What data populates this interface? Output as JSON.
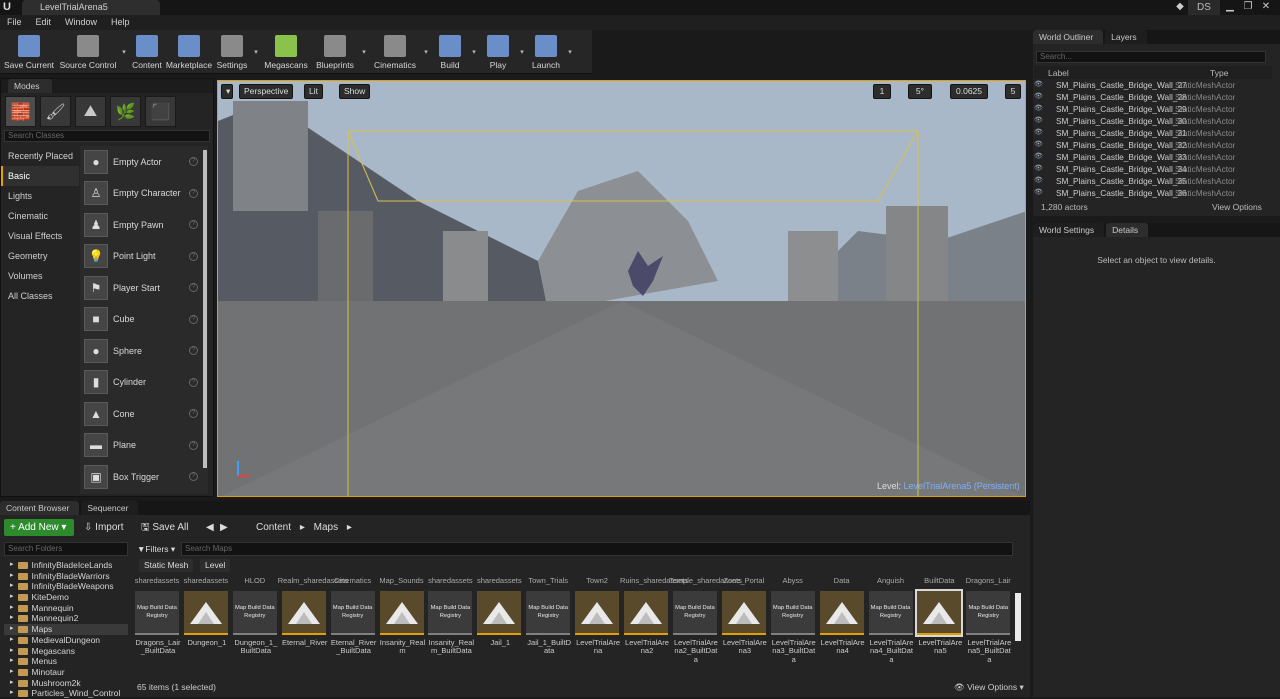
{
  "window": {
    "tab_title": "LevelTrialArena5",
    "user_badge": "DS"
  },
  "menu": [
    "File",
    "Edit",
    "Window",
    "Help"
  ],
  "toolbar": [
    {
      "label": "Save Current",
      "color": "#6a8fc8"
    },
    {
      "label": "Source Control",
      "color": "#8a8a8a"
    },
    {
      "label": "Content",
      "color": "#6a8fc8"
    },
    {
      "label": "Marketplace",
      "color": "#6a8fc8"
    },
    {
      "label": "Settings",
      "color": "#8a8a8a"
    },
    {
      "label": "Megascans",
      "color": "#8bc34a"
    },
    {
      "label": "Blueprints",
      "color": "#8a8a8a"
    },
    {
      "label": "Cinematics",
      "color": "#8a8a8a"
    },
    {
      "label": "Build",
      "color": "#6a8fc8"
    },
    {
      "label": "Play",
      "color": "#6a8fc8"
    },
    {
      "label": "Launch",
      "color": "#6a8fc8"
    }
  ],
  "modes": {
    "tab": "Modes",
    "search_placeholder": "Search Classes",
    "categories": [
      "Recently Placed",
      "Basic",
      "Lights",
      "Cinematic",
      "Visual Effects",
      "Geometry",
      "Volumes",
      "All Classes"
    ],
    "selected_category": "Basic",
    "items": [
      "Empty Actor",
      "Empty Character",
      "Empty Pawn",
      "Point Light",
      "Player Start",
      "Cube",
      "Sphere",
      "Cylinder",
      "Cone",
      "Plane",
      "Box Trigger"
    ]
  },
  "viewport": {
    "perspective": "Perspective",
    "lit": "Lit",
    "show": "Show",
    "grid_snap": "1",
    "angle_snap": "5°",
    "scale_snap": "0.0625",
    "cam_speed": "5",
    "level_label": "Level:",
    "level_name": "LevelTrialArena5 (Persistent)"
  },
  "outliner": {
    "tab": "World Outliner",
    "tab2": "Layers",
    "search_placeholder": "Search...",
    "col_label": "Label",
    "col_type": "Type",
    "rows": [
      {
        "name": "SM_Plains_Castle_Bridge_Wall_27",
        "type": "StaticMeshActor"
      },
      {
        "name": "SM_Plains_Castle_Bridge_Wall_28",
        "type": "StaticMeshActor"
      },
      {
        "name": "SM_Plains_Castle_Bridge_Wall_29",
        "type": "StaticMeshActor"
      },
      {
        "name": "SM_Plains_Castle_Bridge_Wall_30",
        "type": "StaticMeshActor"
      },
      {
        "name": "SM_Plains_Castle_Bridge_Wall_31",
        "type": "StaticMeshActor"
      },
      {
        "name": "SM_Plains_Castle_Bridge_Wall_32",
        "type": "StaticMeshActor"
      },
      {
        "name": "SM_Plains_Castle_Bridge_Wall_33",
        "type": "StaticMeshActor"
      },
      {
        "name": "SM_Plains_Castle_Bridge_Wall_34",
        "type": "StaticMeshActor"
      },
      {
        "name": "SM_Plains_Castle_Bridge_Wall_35",
        "type": "StaticMeshActor"
      },
      {
        "name": "SM_Plains_Castle_Bridge_Wall_36",
        "type": "StaticMeshActor"
      }
    ],
    "count": "1,280 actors",
    "view_options": "View Options"
  },
  "details": {
    "tab": "World Settings",
    "tab2": "Details",
    "message": "Select an object to view details."
  },
  "content_browser": {
    "tab": "Content Browser",
    "tab2": "Sequencer",
    "add_new": "Add New",
    "import": "Import",
    "save_all": "Save All",
    "path": [
      "Content",
      "Maps"
    ],
    "folders_placeholder": "Search Folders",
    "folders": [
      "InfinityBladeIceLands",
      "InfinityBladeWarriors",
      "InfinityBladeWeapons",
      "KiteDemo",
      "Mannequin",
      "Mannequin2",
      "Maps",
      "MedievalDungeon",
      "Megascans",
      "Menus",
      "Minotaur",
      "Mushroom2k",
      "Particles_Wind_Control"
    ],
    "selected_folder": "Maps",
    "filters": "Filters",
    "search_placeholder": "Search Maps",
    "chips": [
      "Static Mesh",
      "Level"
    ],
    "top_labels": [
      "sharedassets",
      "sharedassets",
      "HLOD",
      "Realm_sharedassets",
      "Cinematics",
      "Map_Sounds",
      "sharedassets",
      "sharedassets",
      "Town_Trials",
      "Town2",
      "Ruins_sharedassets",
      "Temple_sharedassets",
      "Zone_Portal",
      "Abyss",
      "Data",
      "Anguish",
      "BuiltData",
      "Dragons_Lair"
    ],
    "assets": [
      {
        "label": "Dragons_Lair_BuiltData",
        "kind": "data"
      },
      {
        "label": "Dungeon_1",
        "kind": "level"
      },
      {
        "label": "Dungeon_1_BuiltData",
        "kind": "data"
      },
      {
        "label": "Eternal_River",
        "kind": "level"
      },
      {
        "label": "Eternal_River_BuiltData",
        "kind": "data"
      },
      {
        "label": "Insanity_Realm",
        "kind": "level"
      },
      {
        "label": "Insanity_Realm_BuiltData",
        "kind": "data"
      },
      {
        "label": "Jail_1",
        "kind": "level"
      },
      {
        "label": "Jail_1_BuiltData",
        "kind": "data"
      },
      {
        "label": "LevelTrialArena",
        "kind": "level"
      },
      {
        "label": "LevelTrialArena2",
        "kind": "level"
      },
      {
        "label": "LevelTrialArena2_BuiltData",
        "kind": "data"
      },
      {
        "label": "LevelTrialArena3",
        "kind": "level"
      },
      {
        "label": "LevelTrialArena3_BuiltData",
        "kind": "data"
      },
      {
        "label": "LevelTrialArena4",
        "kind": "level"
      },
      {
        "label": "LevelTrialArena4_BuiltData",
        "kind": "data"
      },
      {
        "label": "LevelTrialArena5",
        "kind": "level",
        "selected": true
      },
      {
        "label": "LevelTrialArena5_BuiltData",
        "kind": "data"
      }
    ],
    "data_thumb_text": "Map Build Data Registry",
    "status": "65 items (1 selected)",
    "view_options": "View Options"
  }
}
